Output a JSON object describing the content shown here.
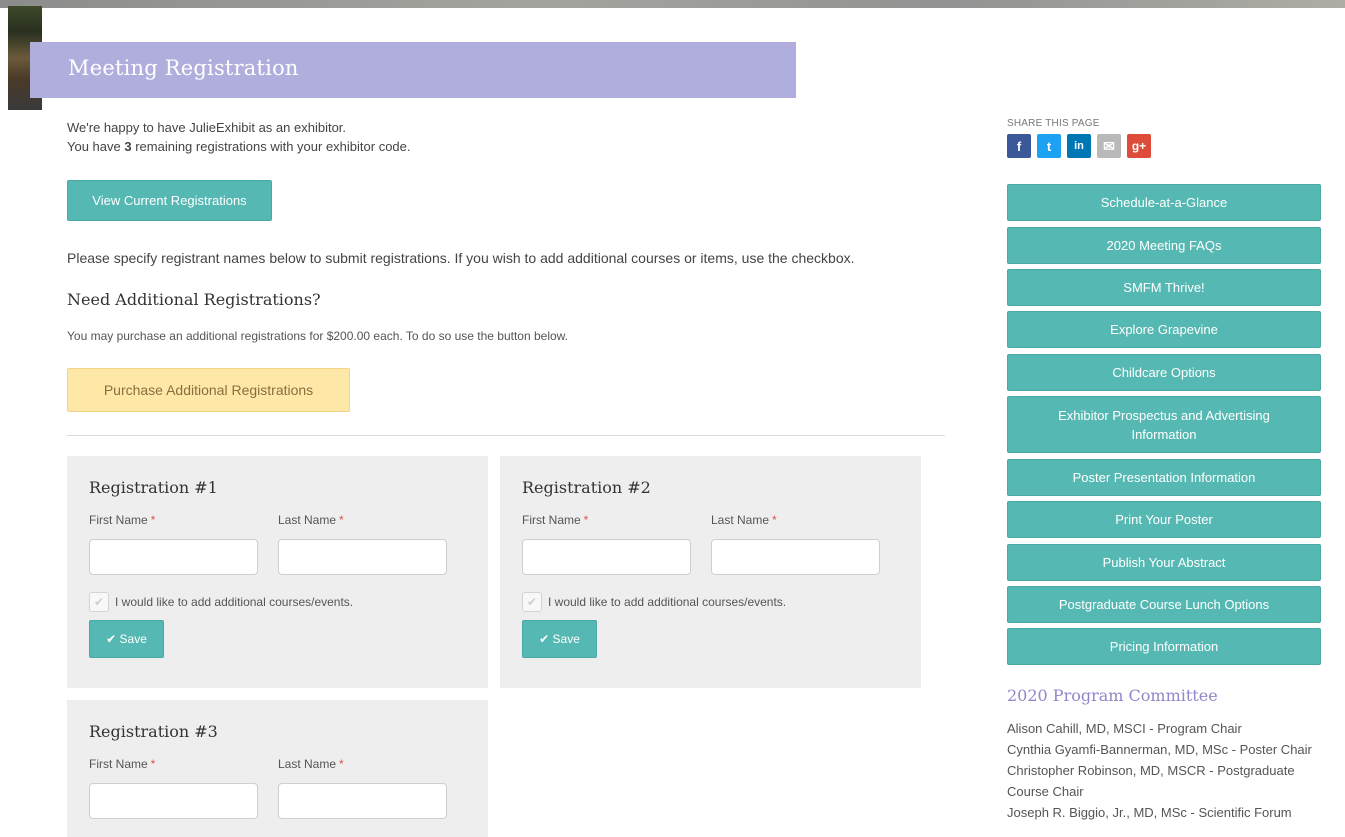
{
  "header": {
    "title": "Meeting Registration"
  },
  "intro": {
    "line1": "We're happy to have JulieExhibit as an exhibitor.",
    "line2_pre": "You have ",
    "line2_count": "3",
    "line2_post": " remaining registrations with your exhibitor code."
  },
  "view_button": "View Current Registrations",
  "instructions": "Please specify registrant names below to submit registrations. If you wish to add additional courses or items, use the checkbox.",
  "additional": {
    "heading": "Need Additional Registrations?",
    "note": "You may purchase an additional registrations for $200.00 each. To do so use the button below.",
    "button": "Purchase Additional Registrations"
  },
  "registrations": [
    {
      "title": "Registration #1",
      "first_label": "First Name",
      "last_label": "Last Name",
      "required_mark": "*",
      "first_value": "",
      "last_value": "",
      "checkbox_label": "I would like to add additional courses/events.",
      "save_label": "Save"
    },
    {
      "title": "Registration #2",
      "first_label": "First Name",
      "last_label": "Last Name",
      "required_mark": "*",
      "first_value": "",
      "last_value": "",
      "checkbox_label": "I would like to add additional courses/events.",
      "save_label": "Save"
    },
    {
      "title": "Registration #3",
      "first_label": "First Name",
      "last_label": "Last Name",
      "required_mark": "*",
      "first_value": "",
      "last_value": ""
    }
  ],
  "sidebar": {
    "share_label": "SHARE THIS PAGE",
    "share_icons": [
      {
        "name": "facebook-icon",
        "glyph": "f",
        "color": "#3b5998"
      },
      {
        "name": "twitter-icon",
        "glyph": "t",
        "color": "#1da1f2"
      },
      {
        "name": "linkedin-icon",
        "glyph": "in",
        "color": "#0077b5"
      },
      {
        "name": "email-icon",
        "glyph": "✉",
        "color": "#b9b9b9"
      },
      {
        "name": "google-plus-icon",
        "glyph": "g+",
        "color": "#dd4b39"
      }
    ],
    "links": [
      "Schedule-at-a-Glance",
      "2020 Meeting FAQs",
      "SMFM Thrive!",
      "Explore Grapevine",
      "Childcare Options",
      "Exhibitor Prospectus and Advertising Information",
      "Poster Presentation Information",
      "Print Your Poster",
      "Publish Your Abstract",
      "Postgraduate Course Lunch Options",
      "Pricing Information"
    ],
    "committee_title": "2020 Program Committee",
    "committee_members": [
      "Alison Cahill, MD, MSCI - Program Chair",
      "Cynthia Gyamfi-Bannerman, MD, MSc - Poster Chair",
      "Christopher Robinson, MD, MSCR - Postgraduate Course Chair",
      "Joseph R. Biggio, Jr., MD, MSc - Scientific Forum"
    ]
  },
  "colors": {
    "accent": "#55b8b2",
    "header": "#b0aedd",
    "warning_button": "#fde8a8",
    "committee_title": "#8e87c9"
  }
}
